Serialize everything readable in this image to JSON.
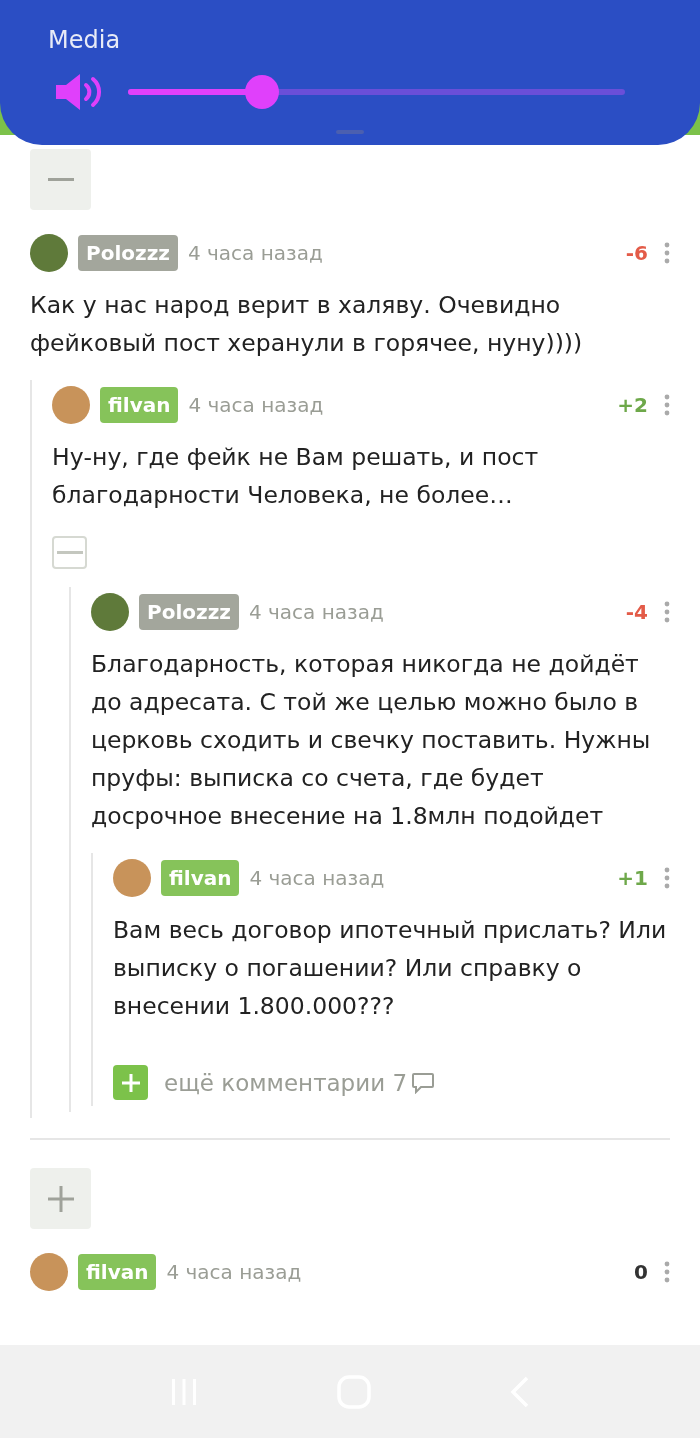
{
  "overlay": {
    "title": "Media",
    "level": 0.27
  },
  "threads": [
    {
      "toggle": {
        "expanded": true
      },
      "comment": {
        "user": "Polozzz",
        "color": "#a3a69c",
        "time": "4 часа назад",
        "rating": {
          "text": "-6",
          "color": "#e35b48"
        },
        "text": "Как у нас народ верит в халяву. Очевидно фейковый пост херанули в горячее, нуну))))",
        "children": [
          {
            "user": "filvan",
            "color": "#86c35a",
            "time": "4 часа назад",
            "rating": {
              "text": "+2",
              "color": "#6ea84a"
            },
            "text": "Ну-ну, где фейк не Вам решать, и пост благодарности Человека, не более…",
            "children_toggle": {
              "expanded": true
            },
            "children": [
              {
                "user": "Polozzz",
                "color": "#a3a69c",
                "time": "4 часа назад",
                "rating": {
                  "text": "-4",
                  "color": "#e35b48"
                },
                "text": "Благодарность, которая никогда не дойдёт до адресата. С той же целью можно было в церковь сходить и свечку поставить. Нужны пруфы: выписка со счета, где будет досрочное внесение на 1.8млн подойдет",
                "more": "ещё комментарии 7",
                "children": [
                  {
                    "user": "filvan",
                    "color": "#86c35a",
                    "time": "4 часа назад",
                    "rating": {
                      "text": "+1",
                      "color": "#6ea84a"
                    },
                    "text": "Вам весь договор ипотечный прислать? Или выписку о погашении? Или справку о внесении 1.800.000???"
                  }
                ]
              }
            ]
          }
        ]
      }
    },
    {
      "toggle": {
        "expanded": false
      },
      "comment": {
        "user": "filvan",
        "color": "#86c35a",
        "time": "4 часа назад",
        "rating": {
          "text": "0",
          "color": "#333333"
        }
      }
    }
  ]
}
